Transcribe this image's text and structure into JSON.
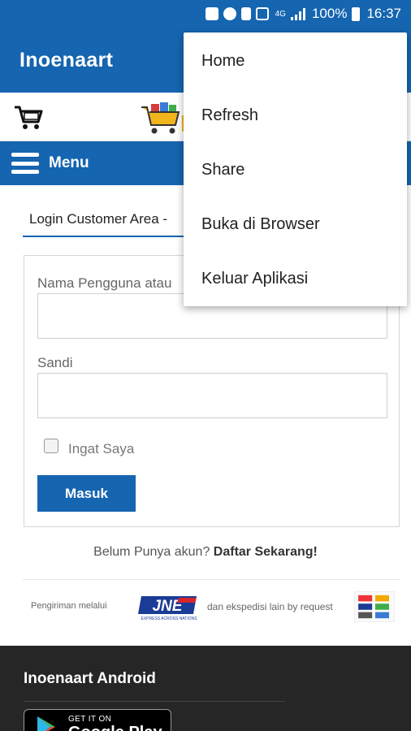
{
  "status_bar": {
    "battery": "100%",
    "time": "16:37",
    "network": "4G",
    "icons": [
      "shield-icon",
      "alarm-icon",
      "sim-icon",
      "signal-icon",
      "battery-icon"
    ]
  },
  "app_bar": {
    "title": "Inoenaart"
  },
  "toolbar": {
    "icons": [
      "cart-icon",
      "shop-logo"
    ]
  },
  "nav": {
    "menu_label": "Menu"
  },
  "login": {
    "tab_label": "Login Customer Area -",
    "username_label": "Nama Pengguna atau",
    "username_value": "",
    "password_label": "Sandi",
    "password_value": "",
    "remember_label": "Ingat Saya",
    "remember_checked": false,
    "submit_label": "Masuk"
  },
  "register": {
    "prompt": "Belum Punya akun?",
    "link_label": "Daftar Sekarang!"
  },
  "shipping": {
    "text_before": "Pengiriman melalui",
    "logo_text": "JNE",
    "logo_tagline": "EXPRESS ACROSS NATIONS",
    "text_after": "dan ekspedisi lain by request"
  },
  "footer": {
    "title": "Inoenaart Android",
    "badge_small": "GET IT ON",
    "badge_big": "Google Play"
  },
  "overflow_menu": {
    "items": [
      {
        "label": "Home"
      },
      {
        "label": "Refresh"
      },
      {
        "label": "Share"
      },
      {
        "label": "Buka di Browser"
      },
      {
        "label": "Keluar Aplikasi"
      }
    ]
  },
  "colors": {
    "primary": "#1565b0",
    "footer_bg": "#262626"
  }
}
